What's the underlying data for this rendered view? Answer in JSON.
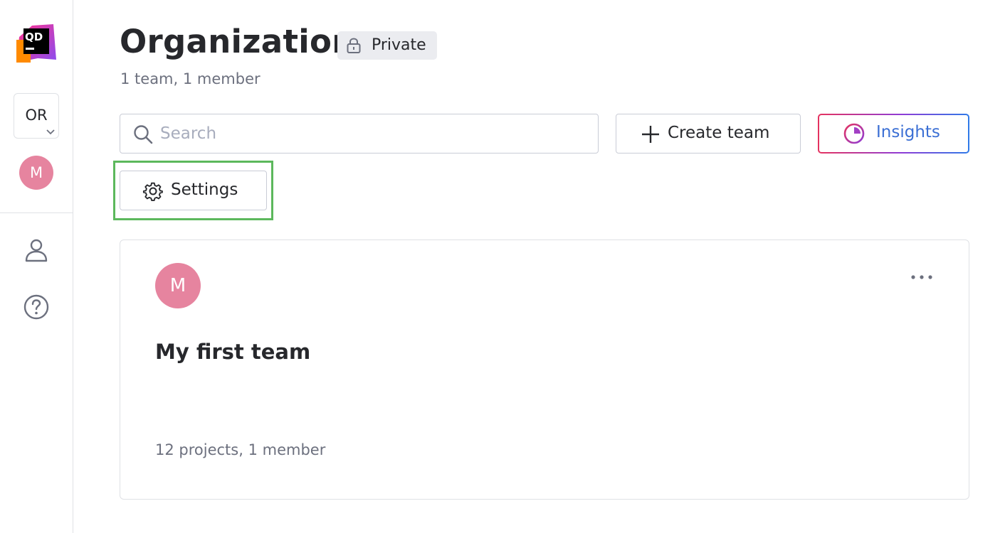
{
  "sidebar": {
    "logo_text": "QD",
    "org_switcher_label": "OR",
    "user_avatar_initial": "M",
    "icons": [
      "profile-icon",
      "help-icon"
    ]
  },
  "header": {
    "title": "Organization",
    "privacy_badge": "Private",
    "subtitle": "1 team, 1 member"
  },
  "toolbar": {
    "search_placeholder": "Search",
    "search_value": "",
    "create_team_label": "Create team",
    "insights_label": "Insights",
    "settings_label": "Settings"
  },
  "teams": [
    {
      "avatar_initial": "M",
      "name": "My first team",
      "meta": "12 projects, 1 member"
    }
  ],
  "colors": {
    "avatar": "#e6849f",
    "highlight": "#5cb85c",
    "insights_text": "#3b6fd4",
    "insights_gradient": [
      "#e5325f",
      "#8f3cd6",
      "#2e7ae8"
    ]
  }
}
